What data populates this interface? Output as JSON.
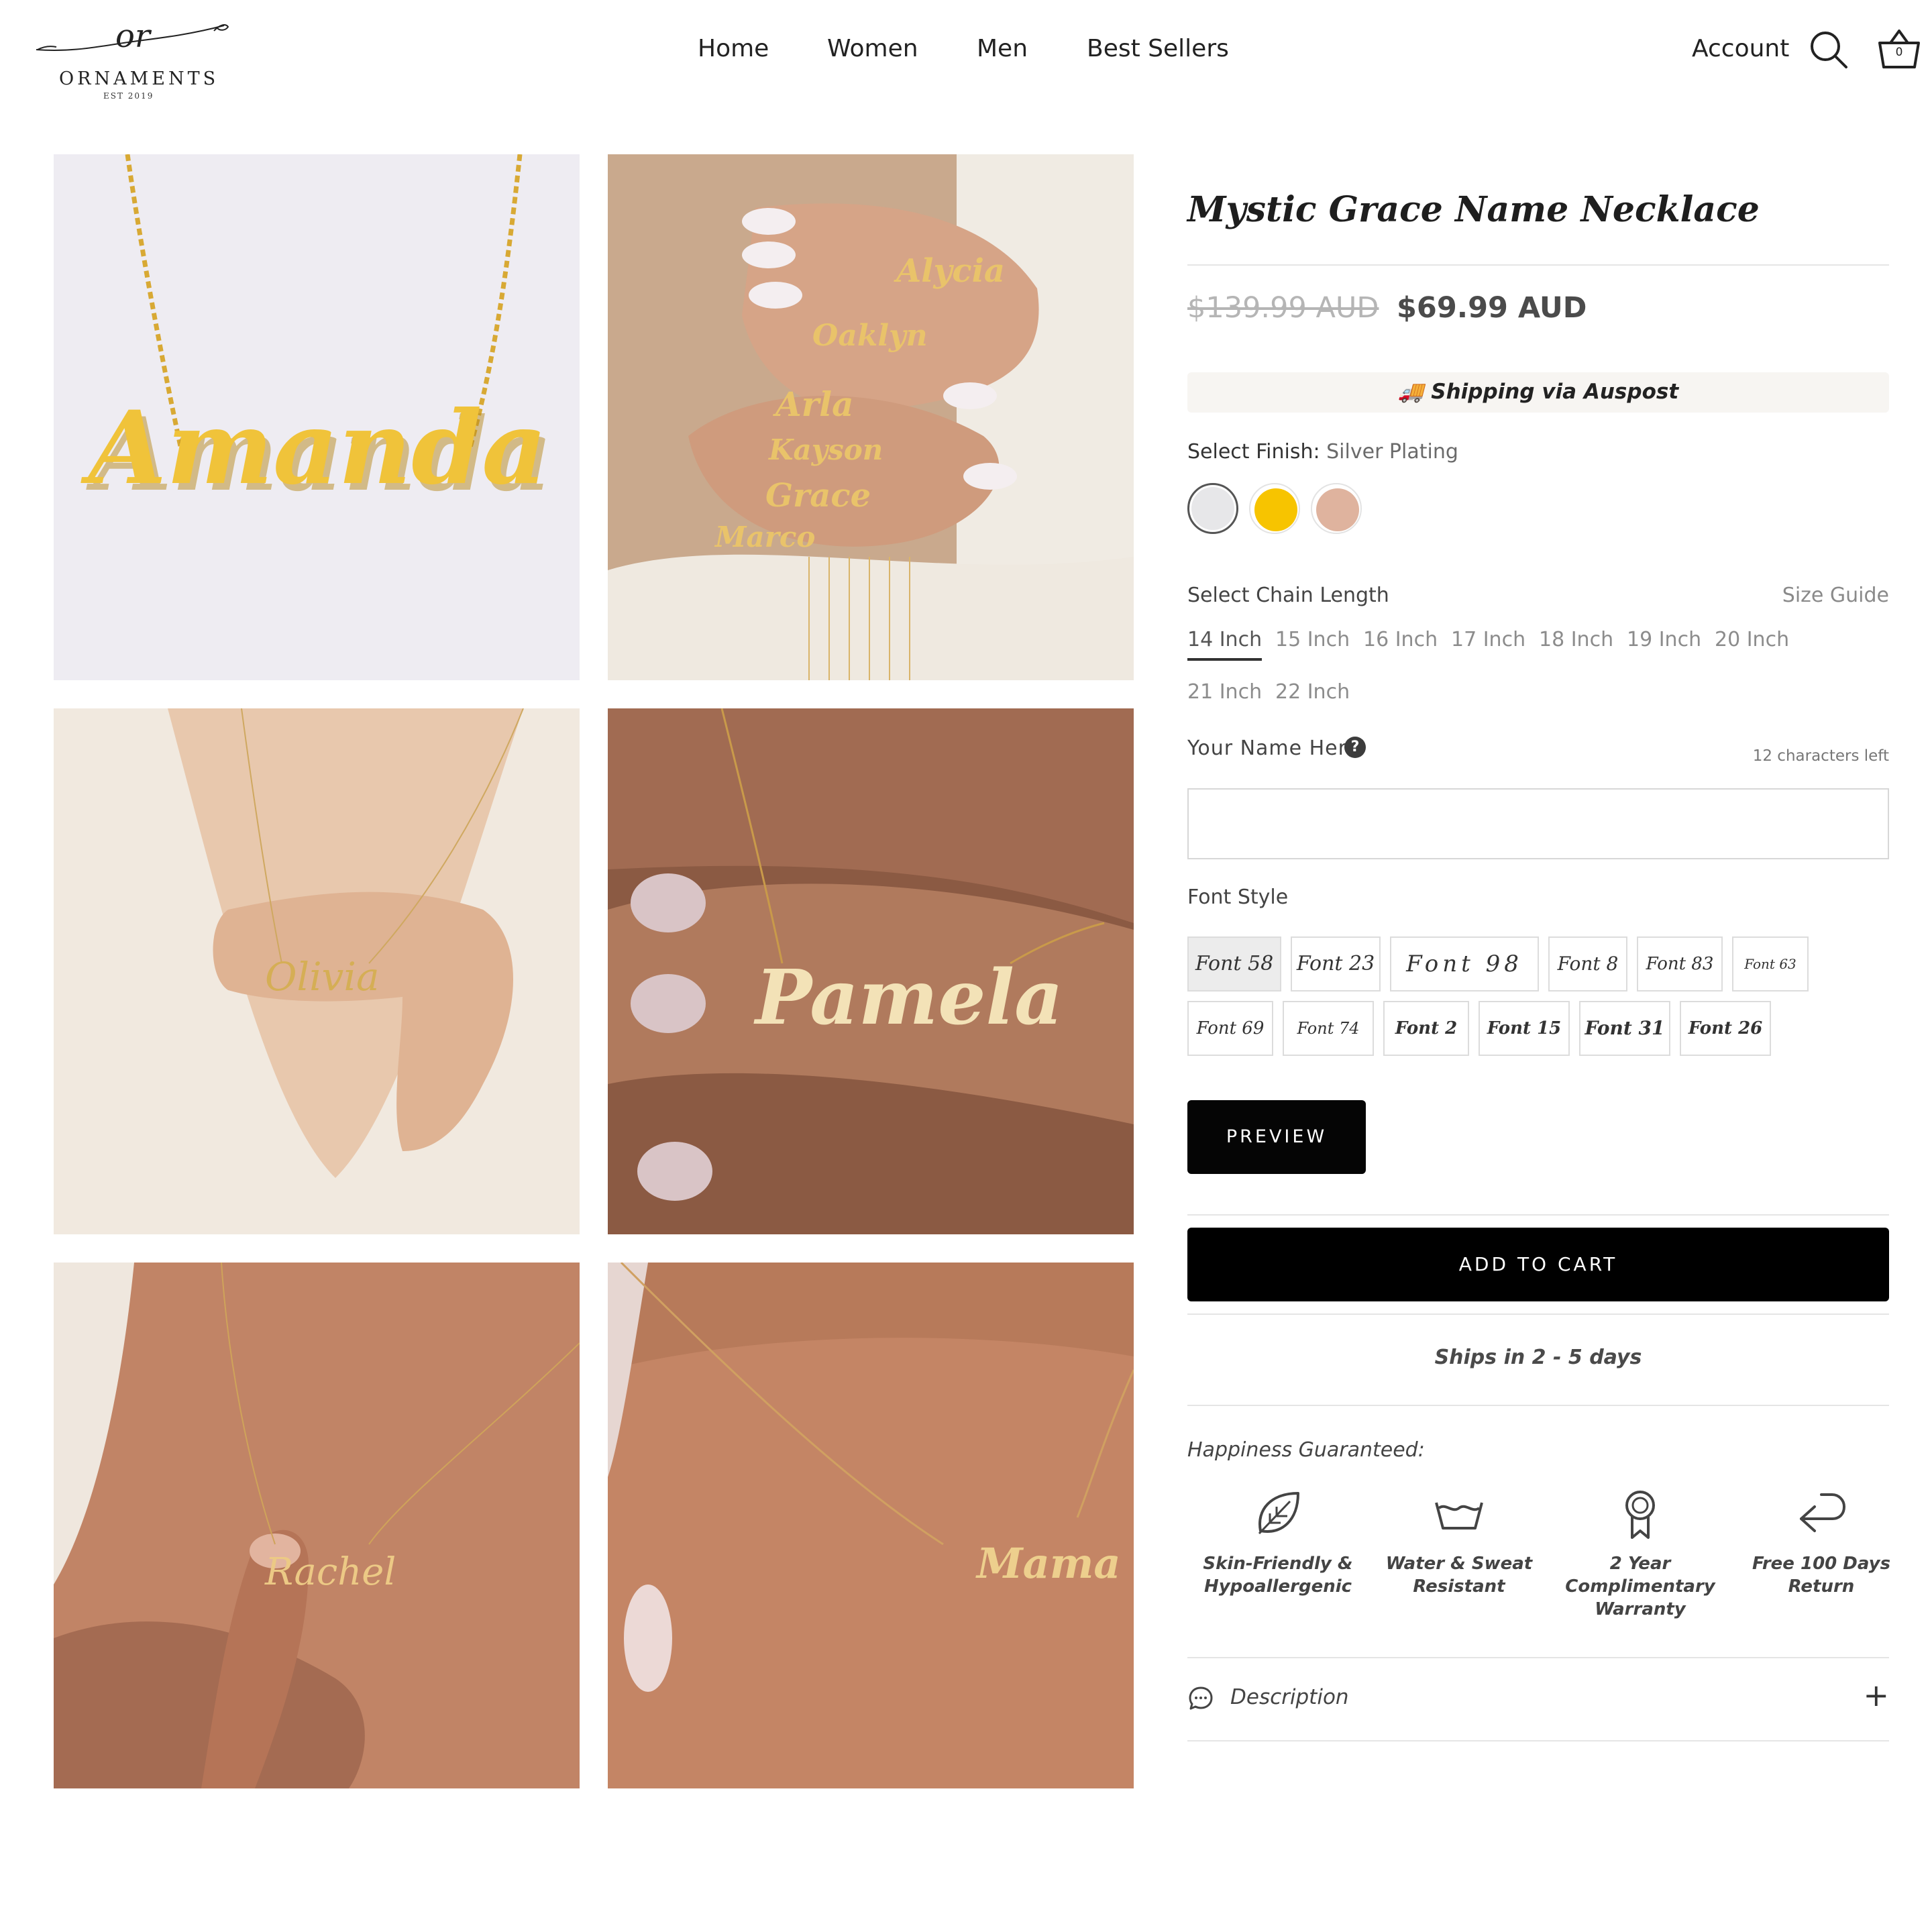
{
  "header": {
    "logo": {
      "monogram": "or",
      "wordmark": "ORNAMENTS",
      "est": "EST 2019"
    },
    "nav": [
      "Home",
      "Women",
      "Men",
      "Best Sellers"
    ],
    "account_label": "Account",
    "cart_count": "0",
    "icons": [
      "search-icon",
      "basket-icon"
    ]
  },
  "gallery": {
    "photos": [
      {
        "caption": "Amanda"
      },
      {
        "names": [
          "Alycia",
          "Oaklyn",
          "Arla",
          "Kayson",
          "Grace",
          "Marco"
        ]
      },
      {
        "caption": "Olivia"
      },
      {
        "caption": "Pamela"
      },
      {
        "caption": "Rachel"
      },
      {
        "caption": "Mama"
      }
    ]
  },
  "product": {
    "title": "Mystic Grace Name Necklace",
    "compare_price": "$139.99 AUD",
    "price": "$69.99 AUD",
    "shipping": {
      "icon": "🚚",
      "text": "Shipping via Auspost"
    },
    "finish": {
      "label": "Select Finish:",
      "value": "Silver Plating",
      "swatches": [
        {
          "name": "Silver Plating",
          "color": "#e7e7e9"
        },
        {
          "name": "Gold Plating",
          "color": "#f7c400"
        },
        {
          "name": "Rose Gold Plating",
          "color": "#dfb39e"
        }
      ]
    },
    "chain": {
      "label": "Select Chain Length",
      "size_guide": "Size Guide",
      "options": [
        "14 Inch",
        "15 Inch",
        "16 Inch",
        "17 Inch",
        "18 Inch",
        "19 Inch",
        "20 Inch",
        "21 Inch",
        "22 Inch"
      ],
      "selected": "14 Inch"
    },
    "name_field": {
      "label": "Your Name Here",
      "help": "?",
      "chars_left": "12 characters left",
      "value": "",
      "placeholder": ""
    },
    "font_style": {
      "label": "Font Style",
      "options": [
        "Font 58",
        "Font 23",
        "Font 98",
        "Font 8",
        "Font 83",
        "Font 63",
        "Font 69",
        "Font 74",
        "Font 2",
        "Font 15",
        "Font 31",
        "Font 26"
      ],
      "selected": "Font 58"
    },
    "preview_label": "PREVIEW",
    "add_to_cart_label": "ADD TO CART",
    "ships_text": "Ships in 2 - 5 days",
    "guarantee": {
      "heading": "Happiness Guaranteed:",
      "features": [
        {
          "icon": "leaf-icon",
          "text": "Skin-Friendly & Hypoallergenic"
        },
        {
          "icon": "wash-basin-icon",
          "text": "Water & Sweat Resistant"
        },
        {
          "icon": "award-ribbon-icon",
          "text": "2 Year Complimentary Warranty"
        },
        {
          "icon": "return-arrow-icon",
          "text": "Free 100 Days Return"
        }
      ]
    },
    "description_label": "Description",
    "description_toggle": "+"
  },
  "colors": {
    "button_bg": "#000000",
    "shipping_bar_bg": "#f7f5f2",
    "gold": "#e2b03a"
  }
}
